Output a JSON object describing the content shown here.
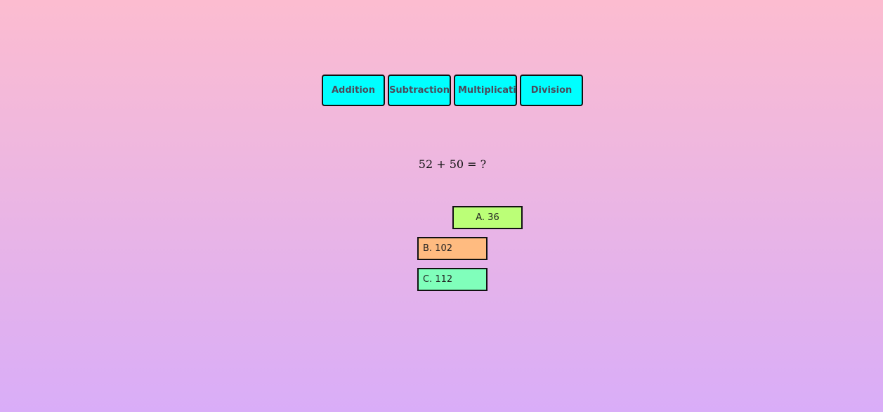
{
  "operations": [
    {
      "label": "Addition"
    },
    {
      "label": "Subtraction"
    },
    {
      "label": "Multiplication"
    },
    {
      "label": "Division"
    }
  ],
  "question": {
    "text": "52 + 50 = ?"
  },
  "answers": [
    {
      "label": "A. 36",
      "color": "#bbff77"
    },
    {
      "label": "B. 102",
      "color": "#ffbb80"
    },
    {
      "label": "C. 112",
      "color": "#80ffbb"
    }
  ],
  "colors": {
    "operation_button": "#00ffff",
    "background_top": "#fcbcd0",
    "background_bottom": "#d9adf8"
  }
}
